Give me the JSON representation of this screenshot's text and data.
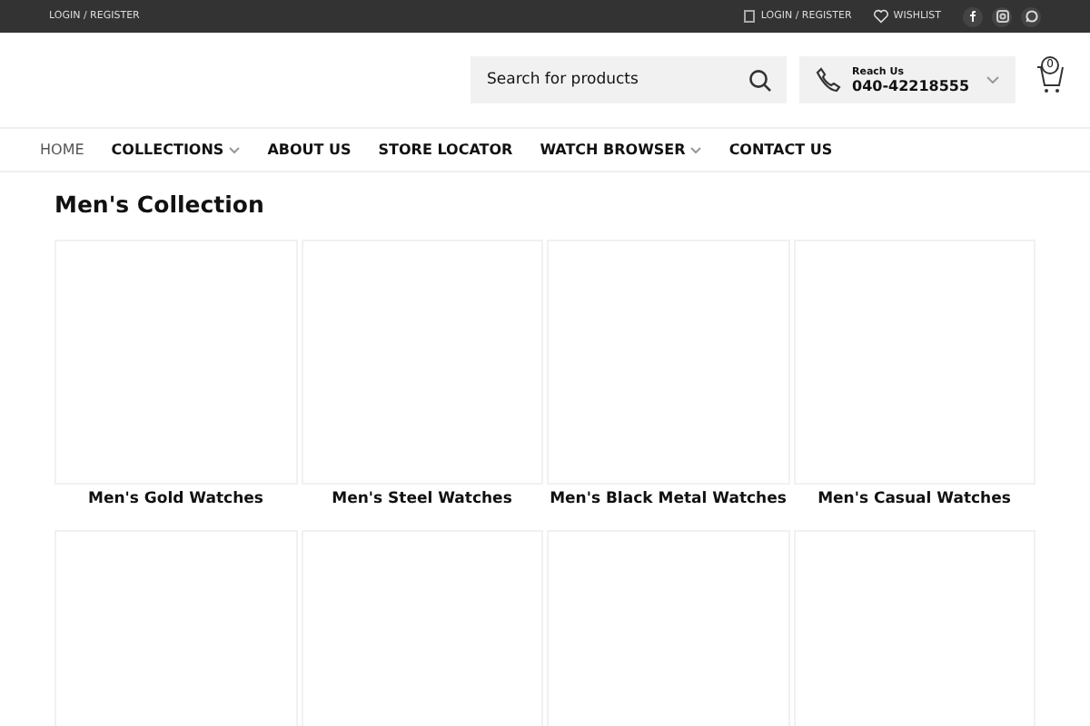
{
  "top_bar": {
    "left_link": "LOGIN / REGISTER",
    "links": [
      {
        "kind": "account",
        "label": "LOGIN / REGISTER"
      },
      {
        "kind": "wishlist",
        "label": "WISHLIST"
      }
    ],
    "social": [
      {
        "kind": "facebook"
      },
      {
        "kind": "instagram"
      },
      {
        "kind": "whatsapp"
      }
    ]
  },
  "header": {
    "search": {
      "placeholder": "Search for products"
    },
    "contact": {
      "label": "Reach Us",
      "phone": "040-42218555"
    },
    "cart": {
      "count": "0"
    }
  },
  "nav": [
    {
      "label": "HOME",
      "selected": true,
      "dropdown": false
    },
    {
      "label": "COLLECTIONS",
      "selected": false,
      "dropdown": true
    },
    {
      "label": "ABOUT US",
      "selected": false,
      "dropdown": false
    },
    {
      "label": "STORE LOCATOR",
      "selected": false,
      "dropdown": false
    },
    {
      "label": "WATCH BROWSER",
      "selected": false,
      "dropdown": true
    },
    {
      "label": "CONTACT US",
      "selected": false,
      "dropdown": false
    }
  ],
  "page_title": "Men's Collection",
  "products": [
    {
      "kind": "labeled",
      "name": "Men's Gold Watches"
    },
    {
      "kind": "labeled",
      "name": "Men's Steel Watches"
    },
    {
      "kind": "labeled",
      "name": "Men's Black Metal Watches"
    },
    {
      "kind": "labeled",
      "name": "Men's Casual Watches"
    },
    {
      "kind": "blank"
    },
    {
      "kind": "blank"
    },
    {
      "kind": "blank"
    },
    {
      "kind": "blank"
    }
  ]
}
